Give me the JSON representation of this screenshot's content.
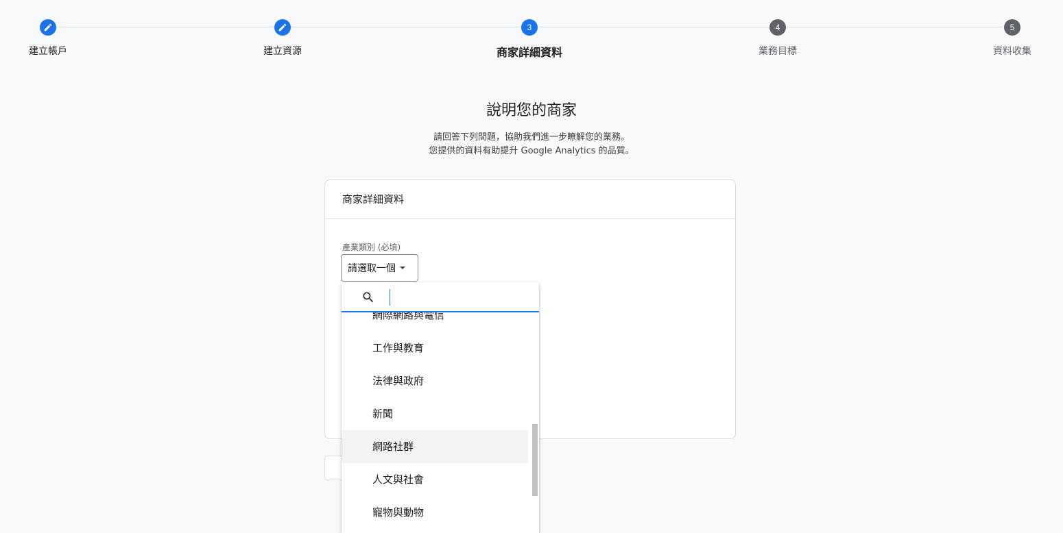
{
  "stepper": {
    "steps": [
      {
        "label": "建立帳戶",
        "state": "done",
        "number": ""
      },
      {
        "label": "建立資源",
        "state": "done",
        "number": ""
      },
      {
        "label": "商家詳細資料",
        "state": "active",
        "number": "3"
      },
      {
        "label": "業務目標",
        "state": "pending",
        "number": "4"
      },
      {
        "label": "資料收集",
        "state": "pending",
        "number": "5"
      }
    ]
  },
  "page": {
    "title": "說明您的商家",
    "subtitle_line1": "請回答下列問題，協助我們進一步瞭解您的業務。",
    "subtitle_line2": "您提供的資料有助提升 Google Analytics 的品質。"
  },
  "card": {
    "header": "商家詳細資料",
    "industry_label": "產業類別 (必填)",
    "industry_select_value": "請選取一個"
  },
  "dropdown": {
    "search_value": "",
    "items": [
      {
        "label": "網際網路與電信",
        "hovered": false
      },
      {
        "label": "工作與教育",
        "hovered": false
      },
      {
        "label": "法律與政府",
        "hovered": false
      },
      {
        "label": "新聞",
        "hovered": false
      },
      {
        "label": "網路社群",
        "hovered": true
      },
      {
        "label": "人文與社會",
        "hovered": false
      },
      {
        "label": "寵物與動物",
        "hovered": false
      }
    ]
  },
  "colors": {
    "accent": "#1a73e8",
    "pending_step": "#5f6368"
  }
}
